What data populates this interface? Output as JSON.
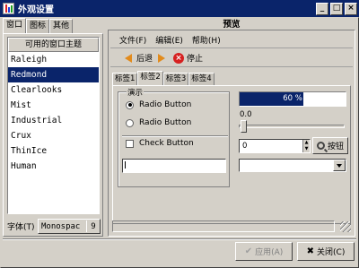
{
  "window": {
    "title": "外观设置",
    "buttons": {
      "minimize": "_",
      "maximize": "□",
      "close": "×"
    }
  },
  "left_tabs": [
    {
      "label": "窗口",
      "active": true
    },
    {
      "label": "图标",
      "active": false
    },
    {
      "label": "其他",
      "active": false
    }
  ],
  "theme_list": {
    "header": "可用的窗口主题",
    "items": [
      "Raleigh",
      "Redmond",
      "Clearlooks",
      "Mist",
      "Industrial",
      "Crux",
      "ThinIce",
      "Human"
    ],
    "selected": "Redmond"
  },
  "font": {
    "label": "字体(T)",
    "name": "Monospac",
    "size": "9"
  },
  "preview": {
    "title": "预览",
    "menu": [
      "文件(F)",
      "编辑(E)",
      "帮助(H)"
    ],
    "toolbar": {
      "back": "后退",
      "stop": "停止"
    },
    "tabs": [
      "标签1",
      "标签2",
      "标签3",
      "标签4"
    ],
    "active_tab": "标签2",
    "frame_label": "演示",
    "radio1": "Radio Button",
    "radio2": "Radio Button",
    "check": "Check Button",
    "progress_text": "60 %",
    "progress_value": 0.6,
    "scale_value": "0.0",
    "spin_value": "0",
    "button_label": "按钮"
  },
  "dialog_buttons": {
    "apply": "应用(A)",
    "close": "关闭(C)"
  },
  "colors": {
    "selection": "#0a246a",
    "face": "#d4d0c8",
    "arrow": "#e28b1c",
    "stop": "#d62020"
  }
}
